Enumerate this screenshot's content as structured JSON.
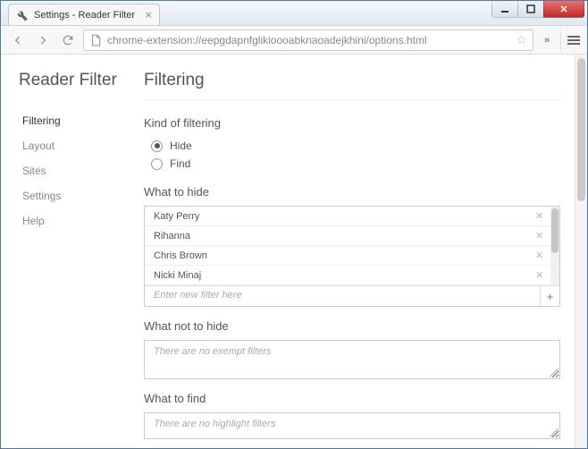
{
  "window": {
    "title": "Settings - Reader Filter"
  },
  "browser": {
    "url": "chrome-extension://eepgdapnfglikioooabknaoadejkhini/options.html"
  },
  "app": {
    "title": "Reader Filter"
  },
  "sidebar": {
    "items": [
      {
        "label": "Filtering",
        "active": true
      },
      {
        "label": "Layout"
      },
      {
        "label": "Sites"
      },
      {
        "label": "Settings"
      },
      {
        "label": "Help"
      }
    ]
  },
  "page": {
    "heading": "Filtering",
    "kind_label": "Kind of filtering",
    "radios": {
      "hide": "Hide",
      "find": "Find"
    },
    "what_to_hide_label": "What to hide",
    "hide_filters": [
      "Katy Perry",
      "Rihanna",
      "Chris Brown",
      "Nicki Minaj"
    ],
    "new_filter_placeholder": "Enter new filter here",
    "what_not_to_hide_label": "What not to hide",
    "exempt_placeholder": "There are no exempt filters",
    "what_to_find_label": "What to find",
    "highlight_placeholder": "There are no highlight filters"
  }
}
